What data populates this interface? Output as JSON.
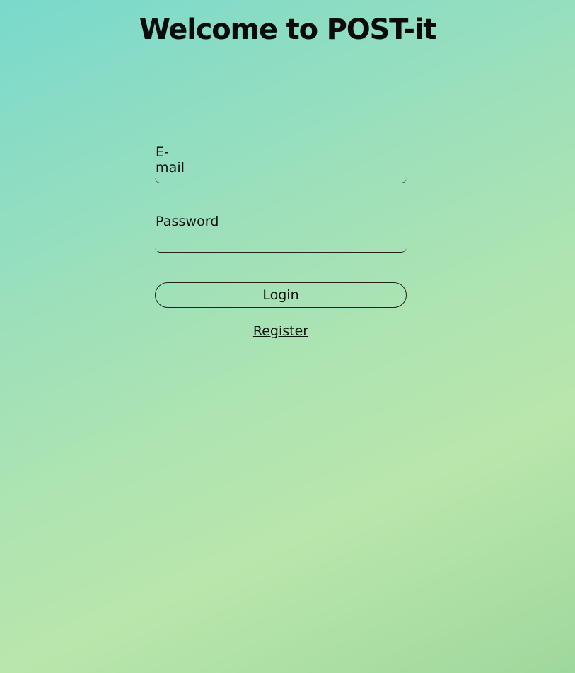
{
  "header": {
    "title": "Welcome to POST-it"
  },
  "login_form": {
    "email": {
      "label": "E-mail",
      "value": "",
      "placeholder": ""
    },
    "password": {
      "label": "Password",
      "value": "",
      "placeholder": ""
    },
    "login_label": "Login",
    "register_label": "Register"
  },
  "colors": {
    "gradient_start": "#79d9cc",
    "gradient_mid": "#aae3b3",
    "gradient_end": "#9fd89c",
    "text": "#111111"
  }
}
